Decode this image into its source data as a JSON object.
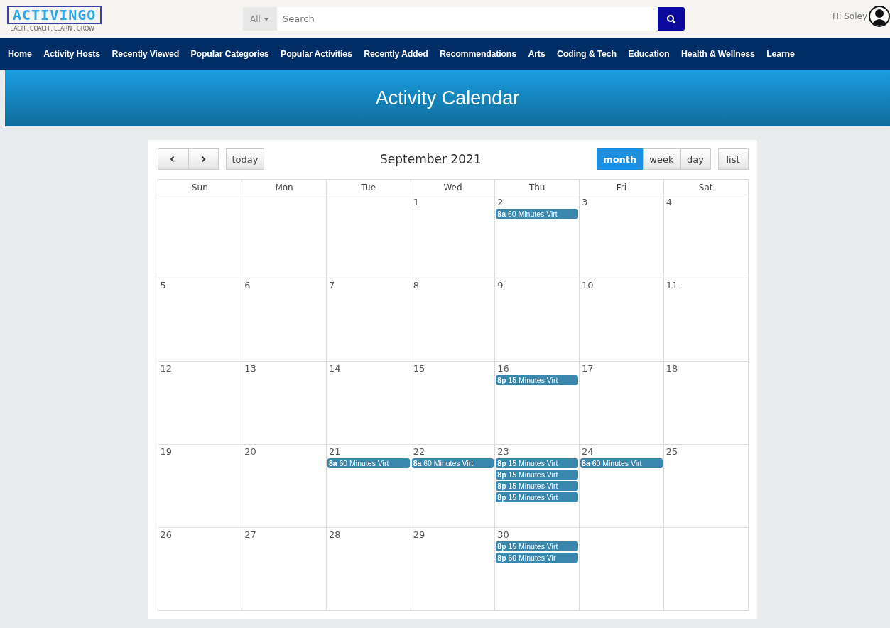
{
  "logo": {
    "name": "ACTIVINGO",
    "tagline": "TEACH . COACH . LEARN . GROW"
  },
  "search": {
    "category": "All",
    "placeholder": "Search"
  },
  "user": {
    "greeting": "Hi Soley"
  },
  "nav": [
    "Home",
    "Activity Hosts",
    "Recently Viewed",
    "Popular Categories",
    "Popular Activities",
    "Recently Added",
    "Recommendations",
    "Arts",
    "Coding & Tech",
    "Education",
    "Health & Wellness",
    "Learne"
  ],
  "banner": {
    "title": "Activity Calendar"
  },
  "calendar": {
    "title": "September 2021",
    "today": "today",
    "views": [
      {
        "label": "month",
        "selected": true
      },
      {
        "label": "week",
        "selected": false
      },
      {
        "label": "day",
        "selected": false
      }
    ],
    "list": "list",
    "weekdays": [
      "Sun",
      "Mon",
      "Tue",
      "Wed",
      "Thu",
      "Fri",
      "Sat"
    ],
    "weeks": [
      [
        {
          "kind": "blank"
        },
        {
          "kind": "blank"
        },
        {
          "kind": "blank"
        },
        {
          "day": "1"
        },
        {
          "day": "2",
          "events": [
            {
              "time": "8a",
              "title": "60 Minutes Virt"
            }
          ]
        },
        {
          "day": "3"
        },
        {
          "day": "4"
        }
      ],
      [
        {
          "day": "5"
        },
        {
          "day": "6"
        },
        {
          "day": "7"
        },
        {
          "day": "8"
        },
        {
          "day": "9"
        },
        {
          "day": "10"
        },
        {
          "day": "11"
        }
      ],
      [
        {
          "day": "12"
        },
        {
          "day": "13"
        },
        {
          "day": "14"
        },
        {
          "day": "15"
        },
        {
          "day": "16",
          "events": [
            {
              "time": "8p",
              "title": "15 Minutes Virt"
            }
          ]
        },
        {
          "day": "17"
        },
        {
          "day": "18"
        }
      ],
      [
        {
          "day": "19"
        },
        {
          "day": "20"
        },
        {
          "day": "21",
          "events": [
            {
              "time": "8a",
              "title": "60 Minutes Virt"
            }
          ]
        },
        {
          "day": "22",
          "events": [
            {
              "time": "8a",
              "title": "60 Minutes Virt"
            }
          ]
        },
        {
          "day": "23",
          "events": [
            {
              "time": "8p",
              "title": "15 Minutes Virt"
            },
            {
              "time": "8p",
              "title": "15 Minutes Virt"
            },
            {
              "time": "8p",
              "title": "15 Minutes Virt"
            },
            {
              "time": "8p",
              "title": "15 Minutes Virt"
            }
          ]
        },
        {
          "day": "24",
          "events": [
            {
              "time": "8a",
              "title": "60 Minutes Virt"
            }
          ]
        },
        {
          "day": "25"
        }
      ],
      [
        {
          "day": "26"
        },
        {
          "day": "27"
        },
        {
          "day": "28"
        },
        {
          "day": "29"
        },
        {
          "day": "30",
          "events": [
            {
              "time": "8p",
              "title": "15 Minutes Virt"
            },
            {
              "time": "8p",
              "title": "60 Minutes Vir"
            }
          ]
        },
        {
          "kind": "blank"
        },
        {
          "kind": "blank"
        }
      ]
    ]
  }
}
